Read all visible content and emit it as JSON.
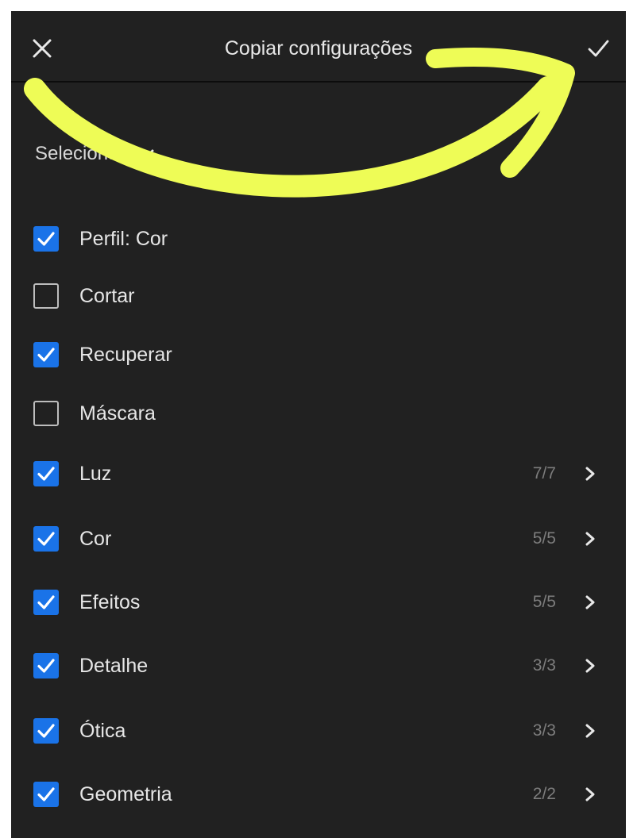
{
  "header": {
    "title": "Copiar configurações",
    "close_icon": "close-icon",
    "confirm_icon": "checkmark-icon"
  },
  "select": {
    "label": "Selecionar",
    "icon": "chevron-down-icon"
  },
  "items": [
    {
      "label": "Perfil: Cor",
      "checked": true,
      "count": ""
    },
    {
      "label": "Cortar",
      "checked": false,
      "count": ""
    },
    {
      "label": "Recuperar",
      "checked": true,
      "count": ""
    },
    {
      "label": "Máscara",
      "checked": false,
      "count": ""
    },
    {
      "label": "Luz",
      "checked": true,
      "count": "7/7"
    },
    {
      "label": "Cor",
      "checked": true,
      "count": "5/5"
    },
    {
      "label": "Efeitos",
      "checked": true,
      "count": "5/5"
    },
    {
      "label": "Detalhe",
      "checked": true,
      "count": "3/3"
    },
    {
      "label": "Ótica",
      "checked": true,
      "count": "3/3"
    },
    {
      "label": "Geometria",
      "checked": true,
      "count": "2/2"
    }
  ],
  "colors": {
    "panel_bg": "#212121",
    "accent": "#1a73e8",
    "annotation_arrow": "#eefc56"
  }
}
